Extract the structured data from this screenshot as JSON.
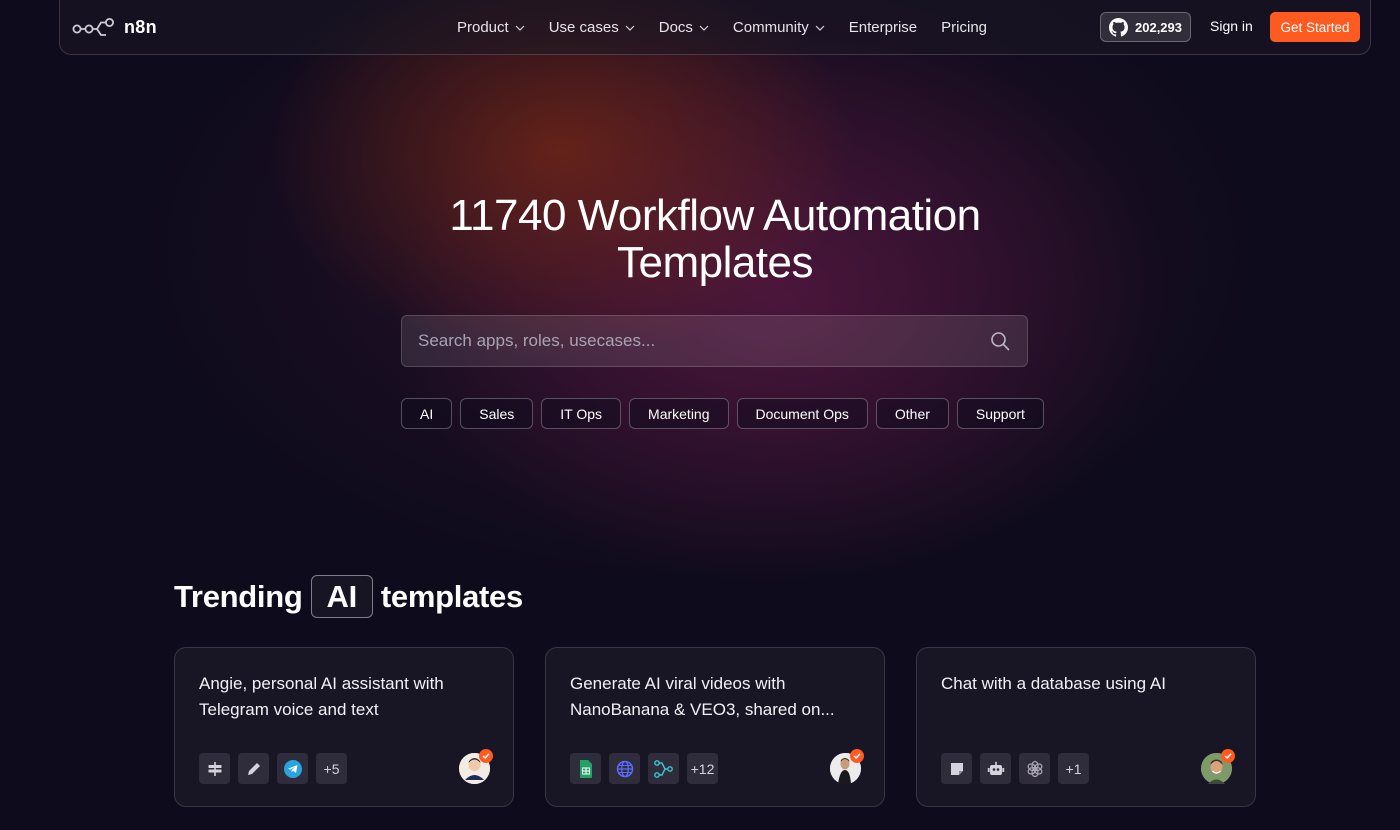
{
  "nav": {
    "logo_text": "n8n",
    "links": [
      {
        "label": "Product",
        "dropdown": true
      },
      {
        "label": "Use cases",
        "dropdown": true
      },
      {
        "label": "Docs",
        "dropdown": true
      },
      {
        "label": "Community",
        "dropdown": true
      },
      {
        "label": "Enterprise",
        "dropdown": false
      },
      {
        "label": "Pricing",
        "dropdown": false
      }
    ],
    "github_stars": "202,293",
    "sign_in": "Sign in",
    "get_started": "Get Started"
  },
  "hero": {
    "title_line1": "11740 Workflow Automation",
    "title_line2": "Templates",
    "search_placeholder": "Search apps, roles, usecases...",
    "categories": [
      "AI",
      "Sales",
      "IT Ops",
      "Marketing",
      "Document Ops",
      "Other",
      "Support"
    ]
  },
  "trending": {
    "prefix": "Trending",
    "tag": "AI",
    "suffix": "templates",
    "cards": [
      {
        "title": "Angie, personal AI assistant with Telegram voice and text",
        "icons": [
          "signpost-icon",
          "pencil-icon",
          "telegram-icon"
        ],
        "more": "+5"
      },
      {
        "title": "Generate AI viral videos with NanoBanana & VEO3, shared on...",
        "icons": [
          "google-sheets-icon",
          "globe-icon",
          "workflow-nodes-icon"
        ],
        "more": "+12"
      },
      {
        "title": "Chat with a database using AI",
        "icons": [
          "sticky-note-icon",
          "robot-icon",
          "openai-icon"
        ],
        "more": "+1"
      }
    ]
  },
  "colors": {
    "accent": "#ff5a1f",
    "background": "#0e0b1c"
  }
}
